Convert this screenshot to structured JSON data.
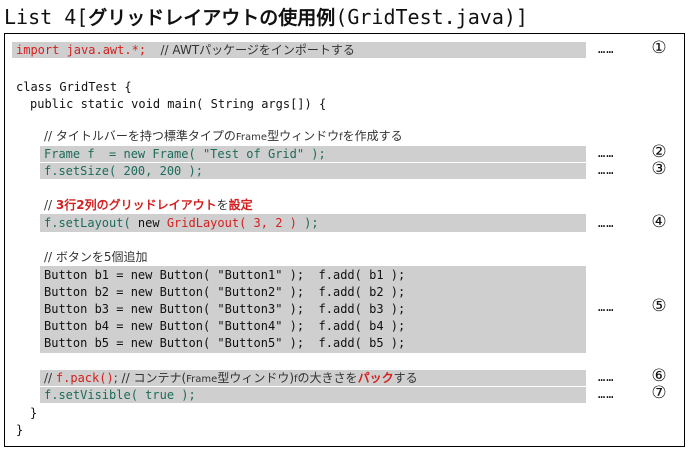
{
  "title": {
    "prefix": "List 4[",
    "jp": "グリッドレイアウトの使用例",
    "suffix": "(GridTest.java)]"
  },
  "code": {
    "import": {
      "code": "import java.awt.*;",
      "comment": "// AWTパッケージをインポートする"
    },
    "class_decl": "class GridTest {",
    "main_decl": "public static void main( String args[]) {",
    "comment_frame": {
      "a": "// タイトルバーを持つ標準タイプの",
      "b": "Frame",
      "c": "型ウィンドウ",
      "d": "f",
      "e": "を作成する"
    },
    "frame_line": "Frame f  = new Frame( \"Test of Grid\" );",
    "setsize_line": "f.setSize( 200, 200 );",
    "comment_layout": {
      "a": "// ",
      "b": "3行2列のグリッドレイアウト",
      "c": "を",
      "d": "設定"
    },
    "setlayout": {
      "a": "f.setLayout( ",
      "b": "new",
      "c": " GridLayout( 3, 2 )",
      "d": " );"
    },
    "comment_buttons": "// ボタンを5個追加",
    "buttons": [
      "Button b1 = new Button( \"Button1\" );  f.add( b1 );",
      "Button b2 = new Button( \"Button2\" );  f.add( b2 );",
      "Button b3 = new Button( \"Button3\" );  f.add( b3 );",
      "Button b4 = new Button( \"Button4\" );  f.add( b4 );",
      "Button b5 = new Button( \"Button5\" );  f.add( b5 );"
    ],
    "pack": {
      "a": "// ",
      "b": "f.pack()",
      "c": "; // コンテナ(",
      "d": "Frame",
      "e": "型ウィンドウ)",
      "f": "f",
      "g": "の大きさを",
      "h": "パック",
      "i": "する"
    },
    "setvisible": "f.setVisible( true );",
    "close_main": "}",
    "close_class": "}"
  },
  "markers": {
    "dots": "……",
    "numbers": [
      "①",
      "②",
      "③",
      "④",
      "⑤",
      "⑥",
      "⑦"
    ]
  }
}
